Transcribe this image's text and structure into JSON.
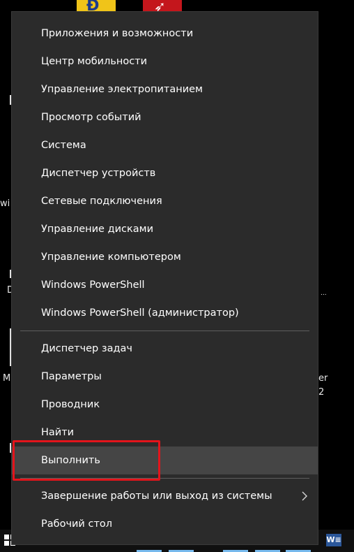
{
  "desktop": {
    "fragments": {
      "wi": "wi",
      "d": "D",
      "m": "M",
      "er": "er",
      "two": "2"
    }
  },
  "context_menu": {
    "group1": [
      {
        "label": "Приложения и возможности"
      },
      {
        "label": "Центр мобильности"
      },
      {
        "label": "Управление электропитанием"
      },
      {
        "label": "Просмотр событий"
      },
      {
        "label": "Система"
      },
      {
        "label": "Диспетчер устройств"
      },
      {
        "label": "Сетевые подключения"
      },
      {
        "label": "Управление дисками"
      },
      {
        "label": "Управление компьютером"
      },
      {
        "label": "Windows PowerShell"
      },
      {
        "label": "Windows PowerShell (администратор)"
      }
    ],
    "group2": [
      {
        "label": "Диспетчер задач"
      },
      {
        "label": "Параметры"
      },
      {
        "label": "Проводник"
      },
      {
        "label": "Найти"
      },
      {
        "label": "Выполнить",
        "highlighted": true
      }
    ],
    "group3": [
      {
        "label": "Завершение работы или выход из системы",
        "has_submenu": true
      },
      {
        "label": "Рабочий стол"
      }
    ]
  },
  "taskbar": {
    "word_icon_text": "W≡"
  },
  "colors": {
    "menu_bg": "#2b2b2b",
    "highlight_bg": "#454545",
    "annotation_border": "#e3141b",
    "taskbar_accent": "#76b9ed"
  }
}
